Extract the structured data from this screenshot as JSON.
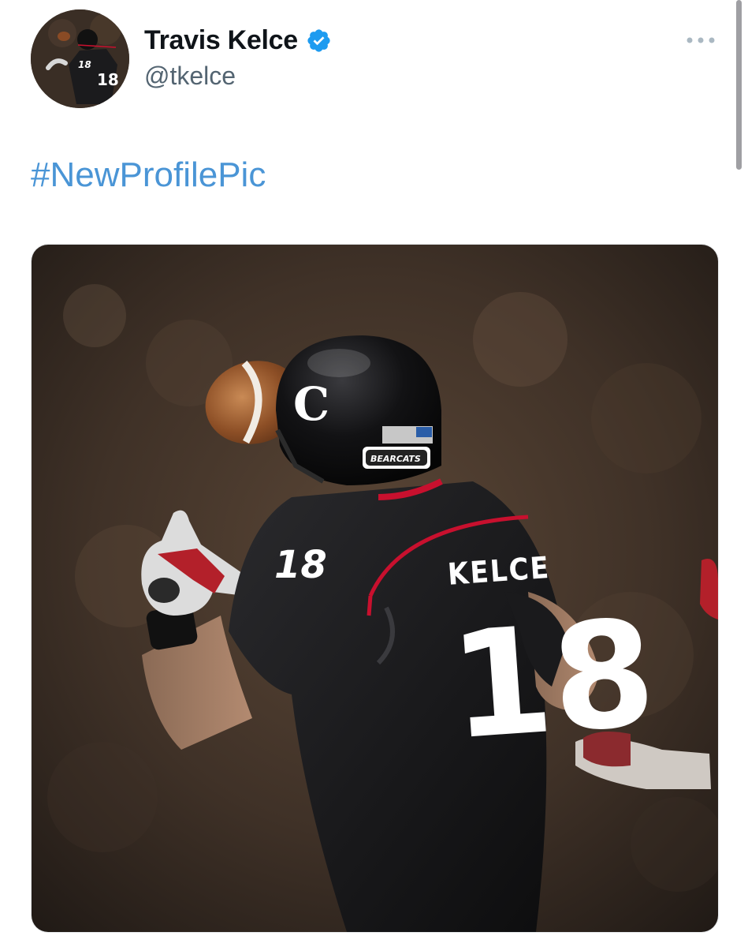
{
  "tweet": {
    "author": {
      "display_name": "Travis Kelce",
      "handle": "@tkelce",
      "verified": true,
      "verified_color": "#1d9bf0"
    },
    "text": {
      "hashtag": "#NewProfilePic",
      "hashtag_color": "#4a95d6"
    },
    "media": {
      "jersey_name": "KELCE",
      "jersey_number": "18",
      "shoulder_number": "18",
      "helmet_logo": "C",
      "helmet_band": "BEARCATS",
      "jersey_accent": "#c8102e"
    },
    "icons": {
      "verified": "verified-badge-icon",
      "more": "more-horizontal-icon"
    }
  }
}
